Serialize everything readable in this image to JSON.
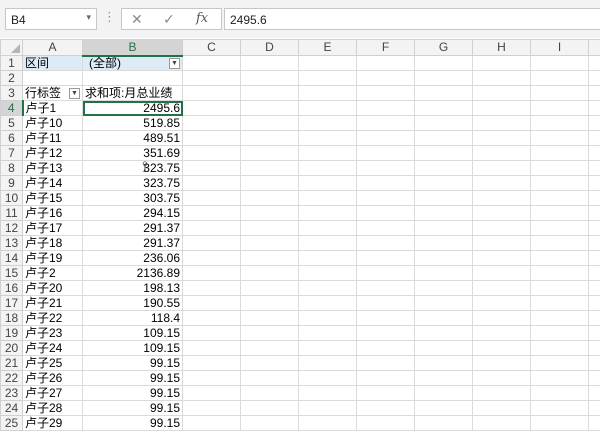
{
  "formula_bar": {
    "name_box": "B4",
    "name_box_arrow": "▾",
    "dots": "⋮",
    "cancel_icon": "✕",
    "enter_icon": "✓",
    "fx_label": "fx",
    "formula_value": "2495.6"
  },
  "columns": [
    "A",
    "B",
    "C",
    "D",
    "E",
    "F",
    "G",
    "H",
    "I",
    ""
  ],
  "rows": [
    {
      "n": "1",
      "a": "区间",
      "b": "(全部)",
      "kind": "filter"
    },
    {
      "n": "2",
      "a": "",
      "b": "",
      "kind": "blank"
    },
    {
      "n": "3",
      "a": "行标签",
      "b": "求和项:月总业绩",
      "kind": "header"
    },
    {
      "n": "4",
      "a": "卢子1",
      "b": "2495.6",
      "kind": "data"
    },
    {
      "n": "5",
      "a": "卢子10",
      "b": "519.85",
      "kind": "data"
    },
    {
      "n": "6",
      "a": "卢子11",
      "b": "489.51",
      "kind": "data"
    },
    {
      "n": "7",
      "a": "卢子12",
      "b": "351.69",
      "kind": "data"
    },
    {
      "n": "8",
      "a": "卢子13",
      "b": "323.75",
      "kind": "data"
    },
    {
      "n": "9",
      "a": "卢子14",
      "b": "323.75",
      "kind": "data"
    },
    {
      "n": "10",
      "a": "卢子15",
      "b": "303.75",
      "kind": "data"
    },
    {
      "n": "11",
      "a": "卢子16",
      "b": "294.15",
      "kind": "data"
    },
    {
      "n": "12",
      "a": "卢子17",
      "b": "291.37",
      "kind": "data"
    },
    {
      "n": "13",
      "a": "卢子18",
      "b": "291.37",
      "kind": "data"
    },
    {
      "n": "14",
      "a": "卢子19",
      "b": "236.06",
      "kind": "data"
    },
    {
      "n": "15",
      "a": "卢子2",
      "b": "2136.89",
      "kind": "data"
    },
    {
      "n": "16",
      "a": "卢子20",
      "b": "198.13",
      "kind": "data"
    },
    {
      "n": "17",
      "a": "卢子21",
      "b": "190.55",
      "kind": "data"
    },
    {
      "n": "18",
      "a": "卢子22",
      "b": "118.4",
      "kind": "data"
    },
    {
      "n": "19",
      "a": "卢子23",
      "b": "109.15",
      "kind": "data"
    },
    {
      "n": "20",
      "a": "卢子24",
      "b": "109.15",
      "kind": "data"
    },
    {
      "n": "21",
      "a": "卢子25",
      "b": "99.15",
      "kind": "data"
    },
    {
      "n": "22",
      "a": "卢子26",
      "b": "99.15",
      "kind": "data"
    },
    {
      "n": "23",
      "a": "卢子27",
      "b": "99.15",
      "kind": "data"
    },
    {
      "n": "24",
      "a": "卢子28",
      "b": "99.15",
      "kind": "data"
    },
    {
      "n": "25",
      "a": "卢子29",
      "b": "99.15",
      "kind": "data"
    }
  ],
  "selected_cell": "B4",
  "dropdown_icon": "▼",
  "colors": {
    "accent": "#217346",
    "pivot_header": "#ddebf7"
  }
}
